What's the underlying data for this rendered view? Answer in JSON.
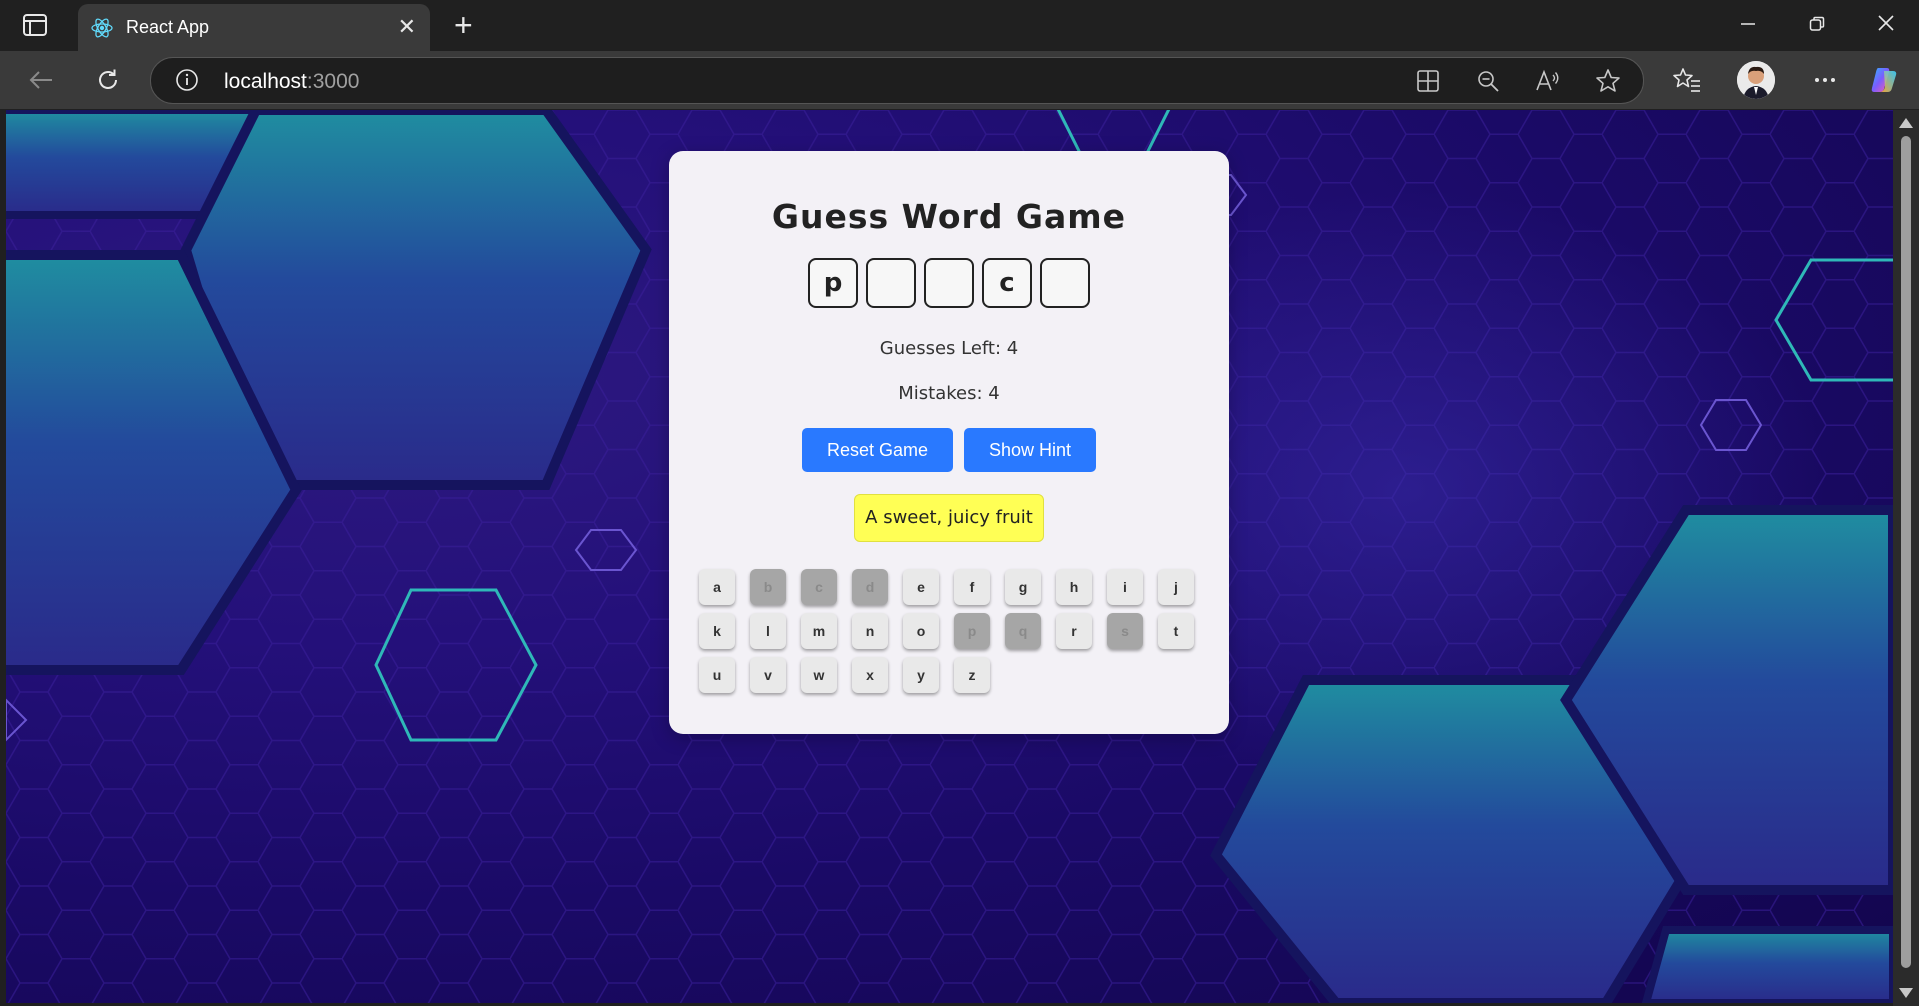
{
  "browser": {
    "tab_title": "React App",
    "url_host": "localhost",
    "url_port": ":3000",
    "icons": [
      "tab-actions-icon",
      "react-favicon",
      "close-icon",
      "plus-icon",
      "minimize-icon",
      "restore-icon",
      "close-window-icon",
      "back-icon",
      "refresh-icon",
      "info-icon",
      "apps-icon",
      "zoom-out-icon",
      "read-aloud-icon",
      "star-icon",
      "favorites-icon",
      "avatar",
      "more-icon",
      "copilot-icon"
    ]
  },
  "game": {
    "title": "Guess Word Game",
    "word_slots": [
      "p",
      "",
      "",
      "c",
      ""
    ],
    "guesses_left": "Guesses Left: 4",
    "mistakes": "Mistakes: 4",
    "reset_label": "Reset Game",
    "hint_label": "Show Hint",
    "hint_text": "A sweet, juicy fruit",
    "keyboard": [
      [
        {
          "k": "a",
          "used": false
        },
        {
          "k": "b",
          "used": true
        },
        {
          "k": "c",
          "used": true
        },
        {
          "k": "d",
          "used": true
        },
        {
          "k": "e",
          "used": false
        },
        {
          "k": "f",
          "used": false
        },
        {
          "k": "g",
          "used": false
        },
        {
          "k": "h",
          "used": false
        },
        {
          "k": "i",
          "used": false
        },
        {
          "k": "j",
          "used": false
        }
      ],
      [
        {
          "k": "k",
          "used": false
        },
        {
          "k": "l",
          "used": false
        },
        {
          "k": "m",
          "used": false
        },
        {
          "k": "n",
          "used": false
        },
        {
          "k": "o",
          "used": false
        },
        {
          "k": "p",
          "used": true
        },
        {
          "k": "q",
          "used": true
        },
        {
          "k": "r",
          "used": false
        },
        {
          "k": "s",
          "used": true
        },
        {
          "k": "t",
          "used": false
        }
      ],
      [
        {
          "k": "u",
          "used": false
        },
        {
          "k": "v",
          "used": false
        },
        {
          "k": "w",
          "used": false
        },
        {
          "k": "x",
          "used": false
        },
        {
          "k": "y",
          "used": false
        },
        {
          "k": "z",
          "used": false
        }
      ]
    ]
  },
  "colors": {
    "button": "#2979ff",
    "hint_bg": "#ffff55",
    "card_bg": "#f3f1f6",
    "background": "#1a0a66",
    "hex_teal": "#1aa6a6"
  }
}
